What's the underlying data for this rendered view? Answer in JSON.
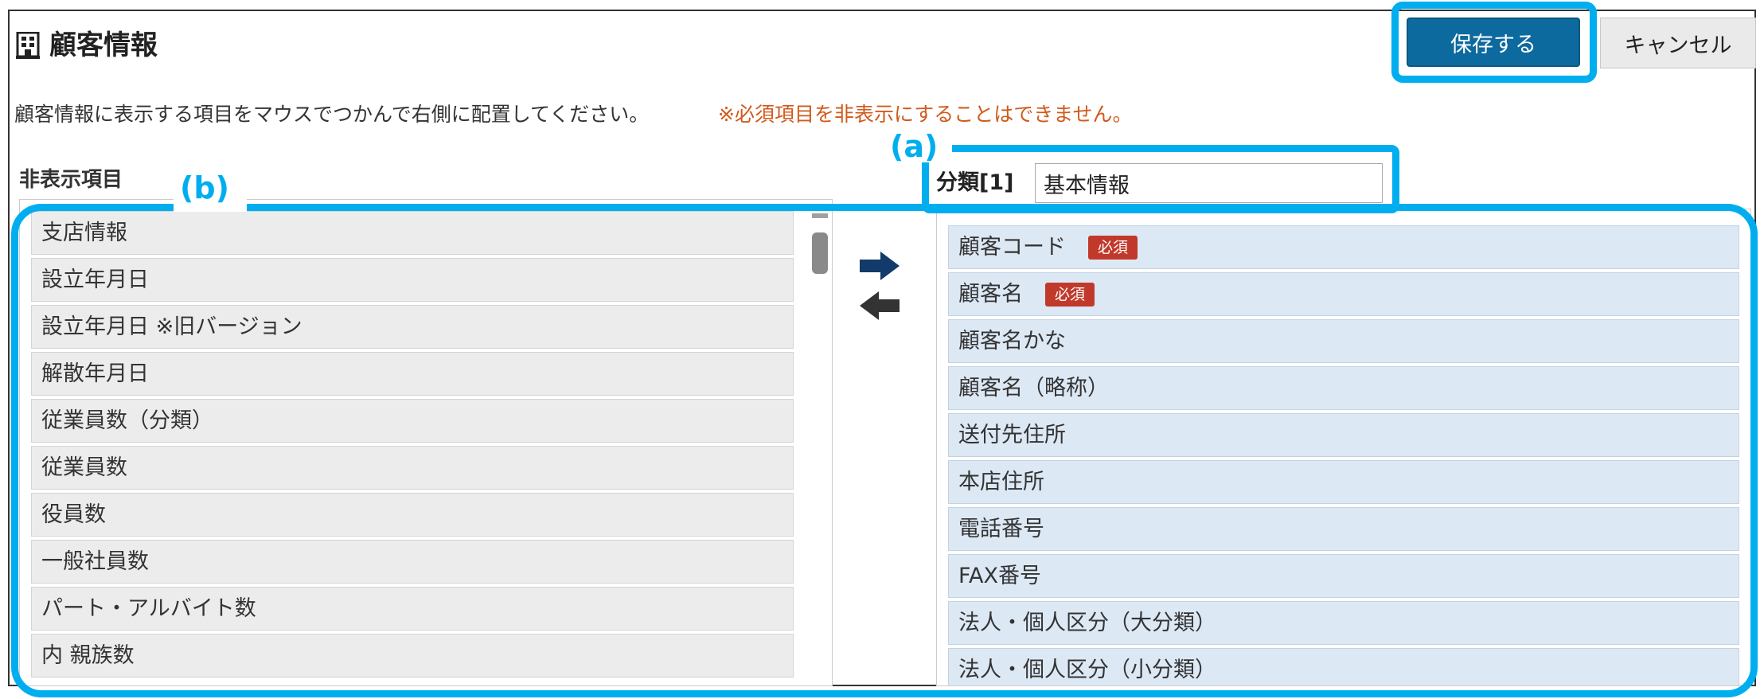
{
  "header": {
    "title": "顧客情報",
    "title_icon": "building-icon",
    "save_label": "保存する",
    "cancel_label": "キャンセル"
  },
  "instructions": {
    "main": "顧客情報に表示する項目をマウスでつかんで右側に配置してください。",
    "warning": "※必須項目を非表示にすることはできません。"
  },
  "markers": {
    "a": "(a)",
    "b": "(b)"
  },
  "hidden": {
    "heading": "非表示項目",
    "items": [
      "支店情報",
      "設立年月日",
      "設立年月日 ※旧バージョン",
      "解散年月日",
      "従業員数（分類）",
      "従業員数",
      "役員数",
      "一般社員数",
      "パート・アルバイト数",
      "内 親族数"
    ]
  },
  "transfer": {
    "right_icon": "arrow-right-icon",
    "left_icon": "arrow-left-icon"
  },
  "category": {
    "label": "分類[1]",
    "value": "基本情報"
  },
  "visible": {
    "required_badge": "必須",
    "items": [
      {
        "label": "顧客コード",
        "required": true
      },
      {
        "label": "顧客名",
        "required": true
      },
      {
        "label": "顧客名かな",
        "required": false
      },
      {
        "label": "顧客名（略称）",
        "required": false
      },
      {
        "label": "送付先住所",
        "required": false
      },
      {
        "label": "本店住所",
        "required": false
      },
      {
        "label": "電話番号",
        "required": false
      },
      {
        "label": "FAX番号",
        "required": false
      },
      {
        "label": "法人・個人区分（大分類）",
        "required": false
      },
      {
        "label": "法人・個人区分（小分類）",
        "required": false
      }
    ]
  },
  "colors": {
    "highlight": "#00aeef",
    "save_button": "#0c6a9e",
    "warning_text": "#d05a1c",
    "required_badge": "#c0392b",
    "visible_item_bg": "#dde8f5",
    "hidden_item_bg": "#ececec"
  }
}
